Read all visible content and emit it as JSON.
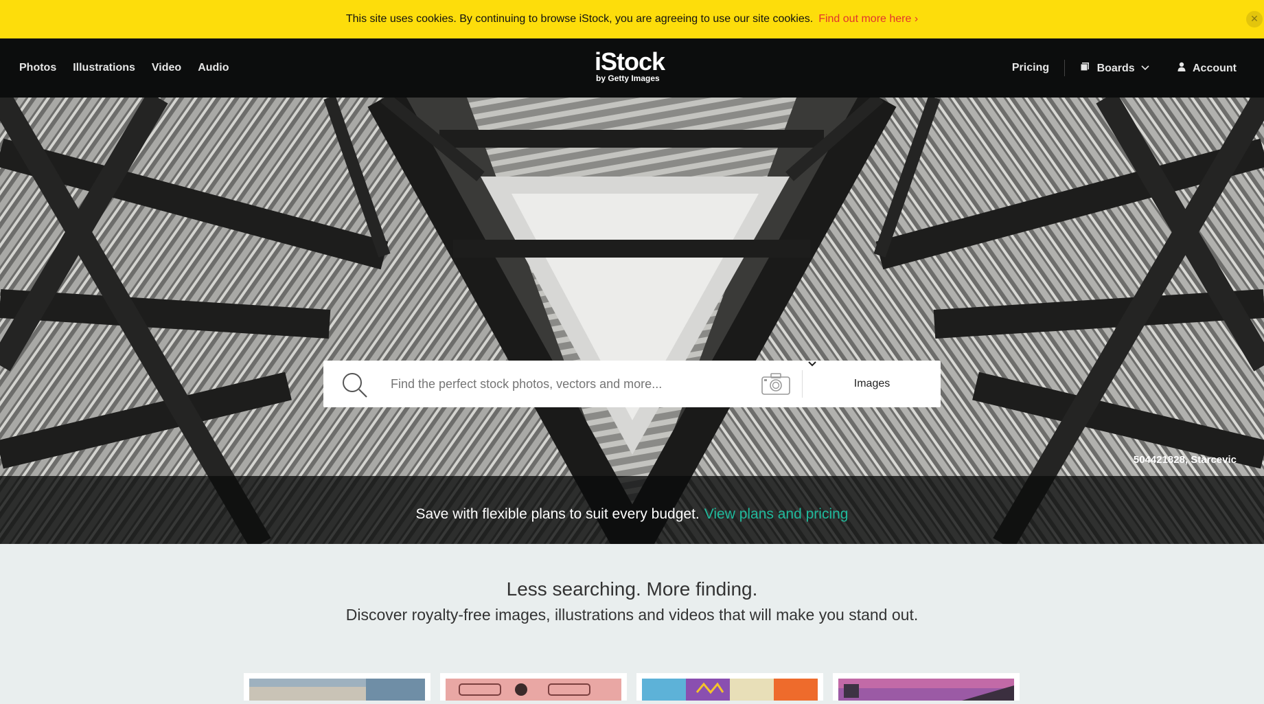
{
  "cookie": {
    "message": "This site uses cookies. By continuing to browse iStock, you are agreeing to use our site cookies.",
    "link": "Find out more here ›",
    "close_icon": "close-icon"
  },
  "nav": {
    "items": [
      {
        "label": "Photos"
      },
      {
        "label": "Illustrations"
      },
      {
        "label": "Video"
      },
      {
        "label": "Audio"
      }
    ],
    "logo_main": "iStock",
    "logo_sub": "by Getty Images",
    "pricing": "Pricing",
    "boards": "Boards",
    "account": "Account"
  },
  "search": {
    "placeholder": "Find the perfect stock photos, vectors and more...",
    "type_label": "Images",
    "icons": [
      "search-icon",
      "camera-icon",
      "chevron-down-icon"
    ]
  },
  "hero": {
    "credit": "504421828, Starcevic",
    "promo_text": "Save with flexible plans to suit every budget.",
    "promo_link": "View plans and pricing"
  },
  "intro": {
    "headline": "Less searching. More finding.",
    "subline": "Discover royalty-free images, illustrations and videos that will make you stand out."
  },
  "colors": {
    "cookie_bar": "#fddd0b",
    "cookie_link": "#e2332e",
    "nav_bg": "#0c0d0d",
    "promo_link": "#1fba9c",
    "page_bg": "#e9eeee"
  }
}
